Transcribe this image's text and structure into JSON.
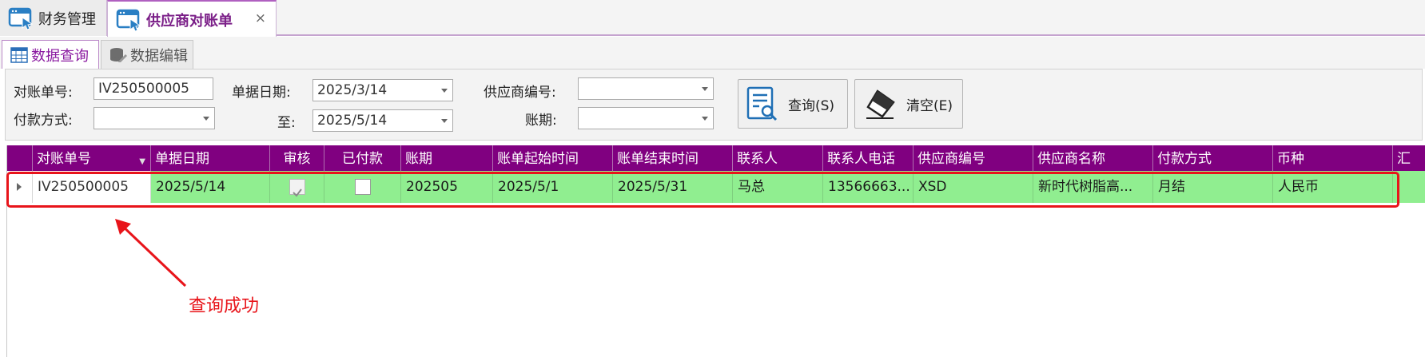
{
  "doc_tabs": [
    {
      "label": "财务管理",
      "active": false
    },
    {
      "label": "供应商对账单",
      "active": true
    }
  ],
  "close_symbol": "×",
  "sub_tabs": [
    {
      "label": "数据查询",
      "active": true
    },
    {
      "label": "数据编辑",
      "active": false
    }
  ],
  "query": {
    "recon_no_label": "对账单号:",
    "recon_no_value": "IV250500005",
    "doc_date_label": "单据日期:",
    "doc_date_from": "2025/3/14",
    "to_label": "至:",
    "doc_date_to": "2025/5/14",
    "supplier_no_label": "供应商编号:",
    "supplier_no_value": "",
    "payment_label": "付款方式:",
    "payment_value": "",
    "period_label": "账期:",
    "period_value": "",
    "search_button": "查询(S)",
    "clear_button": "清空(E)"
  },
  "grid": {
    "columns": [
      "对账单号",
      "单据日期",
      "审核",
      "已付款",
      "账期",
      "账单起始时间",
      "账单结束时间",
      "联系人",
      "联系人电话",
      "供应商编号",
      "供应商名称",
      "付款方式",
      "币种",
      "汇"
    ],
    "rows": [
      {
        "recon_no": "IV250500005",
        "doc_date": "2025/5/14",
        "audited": true,
        "paid": false,
        "period": "202505",
        "start": "2025/5/1",
        "end": "2025/5/31",
        "contact": "马总",
        "phone": "13566663...",
        "supplier_no": "XSD",
        "supplier_name": "新时代树脂高...",
        "payment": "月结",
        "currency": "人民币"
      }
    ]
  },
  "annotation": "查询成功",
  "colors": {
    "header": "#800080",
    "row_ok": "#90ee90",
    "annotation": "#e8141a"
  }
}
